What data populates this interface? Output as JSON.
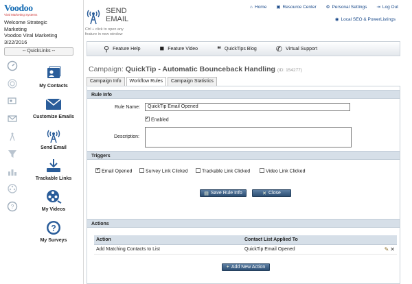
{
  "brand": {
    "name": "Voodoo",
    "tagline": "Viral Marketing Systems"
  },
  "welcome": {
    "line1": "Welcome Strategic",
    "line2": "Marketing",
    "line3": "Voodoo Viral Marketing",
    "date": "3/22/2016"
  },
  "quicklinks": {
    "label": "-- QuickLinks --"
  },
  "left_rail": [
    "dashboard-icon",
    "target-icon",
    "contacts-icon",
    "email-icon",
    "broadcast-icon",
    "funnel-icon",
    "chart-icon",
    "film-icon",
    "help-icon"
  ],
  "nav": [
    {
      "label": "My Contacts",
      "icon": "contacts-icon"
    },
    {
      "label": "Customize Emails",
      "icon": "envelope-icon"
    },
    {
      "label": "Send Email",
      "icon": "broadcast-icon"
    },
    {
      "label": "Trackable Links",
      "icon": "download-icon"
    },
    {
      "label": "My Videos",
      "icon": "film-reel-icon"
    },
    {
      "label": "My Surveys",
      "icon": "question-icon"
    }
  ],
  "header": {
    "title_line1": "SEND",
    "title_line2": "EMAIL",
    "hint_line1": "Ctrl + click to open any",
    "hint_line2": "feature in new window"
  },
  "top_links": [
    {
      "label": "Home",
      "icon": "home-icon"
    },
    {
      "label": "Resource Center",
      "icon": "resource-icon"
    },
    {
      "label": "Personal Settings",
      "icon": "gear-icon"
    },
    {
      "label": "Log Out",
      "icon": "logout-icon"
    }
  ],
  "local_link": {
    "label": "Local SEO & PowerListings",
    "icon": "globe-icon"
  },
  "toolbar": [
    {
      "label": "Feature Help",
      "icon": "help-icon"
    },
    {
      "label": "Feature Video",
      "icon": "video-camera-icon"
    },
    {
      "label": "QuickTips Blog",
      "icon": "blog-icon"
    },
    {
      "label": "Virtual Support",
      "icon": "phone-icon"
    }
  ],
  "campaign": {
    "prefix": "Campaign:",
    "name": "QuickTip - Automatic Bounceback Handling",
    "id": "(ID: 154277)"
  },
  "tabs": [
    {
      "label": "Campaign Info",
      "active": false
    },
    {
      "label": "Workflow Rules",
      "active": true
    },
    {
      "label": "Campaign Statistics",
      "active": false
    }
  ],
  "rule_info": {
    "heading": "Rule Info",
    "name_label": "Rule Name:",
    "name_value": "QuickTip Email Opened",
    "enabled_label": "Enabled",
    "enabled": true,
    "description_label": "Description:",
    "description_value": ""
  },
  "triggers": {
    "heading": "Triggers",
    "options": [
      {
        "label": "Email Opened",
        "checked": true
      },
      {
        "label": "Survey Link Clicked",
        "checked": false
      },
      {
        "label": "Trackable Link Clicked",
        "checked": false
      },
      {
        "label": "Video Link Clicked",
        "checked": false
      }
    ]
  },
  "buttons": {
    "save": "Save Rule Info",
    "close": "Close",
    "add_action": "Add New Action"
  },
  "actions": {
    "heading": "Actions",
    "columns": [
      "Action",
      "Contact List Applied To"
    ],
    "rows": [
      {
        "action": "Add Matching Contacts to List",
        "list": "QuickTip Email Opened"
      }
    ]
  },
  "colors": {
    "accent": "#2d4f74",
    "section": "#d6dfe8",
    "link": "#1a4a8a"
  }
}
